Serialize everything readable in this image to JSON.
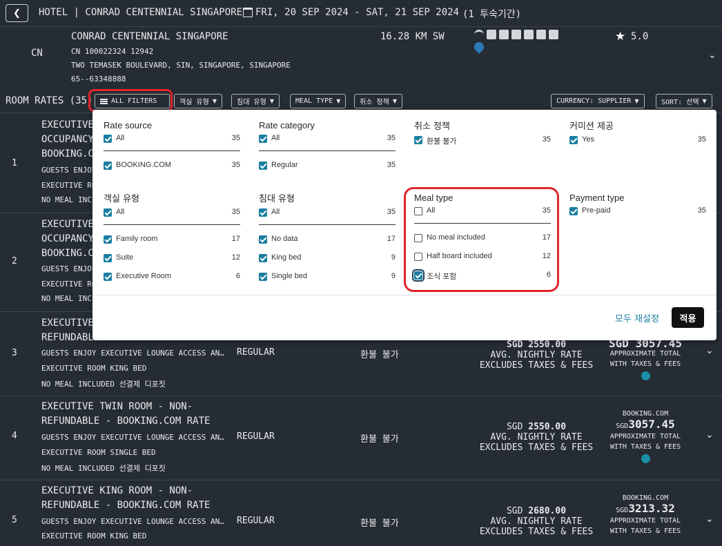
{
  "topbar": {
    "back_icon": "chevron-left-icon",
    "title": "HOTEL | CONRAD CENTENNIAL SINGAPORE",
    "dates": "FRI, 20 SEP 2024 - SAT, 21 SEP 2024",
    "nights": "(1 투숙기간)"
  },
  "hotel": {
    "code": "CN",
    "name": "CONRAD CENTENNIAL SINGAPORE",
    "ids": "CN 100022324 12942",
    "address": "TWO TEMASEK BOULEVARD, SIN, SINGAPORE, SINGAPORE",
    "phone": "65--63348888",
    "distance": "16.28 KM SW",
    "amenities": [
      "wifi-icon",
      "transfer-icon",
      "pool-icon",
      "coffee-icon",
      "bus-icon",
      "restaurant-icon",
      "parking-icon"
    ],
    "rating": "5.0"
  },
  "filterbar": {
    "label": "ROOM RATES (35)",
    "all_filters": "ALL FILTERS",
    "room_type": "객실 유형",
    "bed_type": "침대 유형",
    "meal_type": "MEAL TYPE",
    "cancel_policy": "취소 정책",
    "currency": "CURRENCY: SUPPLIER",
    "sort": "SORT: 선택"
  },
  "rows": [
    {
      "num": "1",
      "title1": "EXECUTIVE",
      "title2": "OCCUPANCY",
      "title3": "BOOKING.C",
      "l1": "GUESTS ENJOY",
      "l2": "EXECUTIVE RO",
      "l3": "NO MEAL INCLU"
    },
    {
      "num": "2",
      "title1": "EXECUTIVE",
      "title2": "OCCUPANCY",
      "title3": "BOOKING.C",
      "l1": "GUESTS ENJO",
      "l2": "EXECUTIVE RO",
      "l3": "NO MEAL INCL"
    },
    {
      "num": "3",
      "title1": "EXECUTIVE",
      "title2": "REFUNDABLE",
      "l1": "GUESTS ENJOY EXECUTIVE LOUNGE ACCESS AN…",
      "l2": "EXECUTIVE ROOM  KING BED",
      "l3": "NO MEAL INCLUDED   선결제   디포짓",
      "cat": "REGULAR",
      "cancel": "환불 불가",
      "price": "SGD 2550.00",
      "avg": "AVG. NIGHTLY RATE",
      "excl": "EXCLUDES TAXES & FEES",
      "total": "SGD 3057.45",
      "approx": "APPROXIMATE TOTAL",
      "with": "WITH TAXES & FEES"
    },
    {
      "num": "4",
      "title1": "EXECUTIVE TWIN ROOM - NON-",
      "title2": "REFUNDABLE - BOOKING.COM RATE",
      "l1": "GUESTS ENJOY EXECUTIVE LOUNGE ACCESS AN…",
      "l2": "EXECUTIVE ROOM  SINGLE BED",
      "l3": "NO MEAL INCLUDED   선결제   디포짓",
      "cat": "REGULAR",
      "cancel": "환불 불가",
      "price_cur": "SGD",
      "price": "2550.00",
      "avg": "AVG. NIGHTLY RATE",
      "excl": "EXCLUDES TAXES & FEES",
      "src": "BOOKING.COM",
      "total_cur": "SGD",
      "total": "3057.45",
      "approx": "APPROXIMATE TOTAL",
      "with": "WITH TAXES & FEES"
    },
    {
      "num": "5",
      "title1": "EXECUTIVE KING ROOM - NON-",
      "title2": "REFUNDABLE - BOOKING.COM RATE",
      "l1": "GUESTS ENJOY EXECUTIVE LOUNGE ACCESS AN…",
      "l2": "EXECUTIVE ROOM  KING BED",
      "cat": "REGULAR",
      "cancel": "환불 불가",
      "price_cur": "SGD",
      "price": "2680.00",
      "avg": "AVG. NIGHTLY RATE",
      "excl": "EXCLUDES TAXES & FEES",
      "src": "BOOKING.COM",
      "total_cur": "SGD",
      "total": "3213.32",
      "approx": "APPROXIMATE TOTAL",
      "with": "WITH TAXES & FEES"
    }
  ],
  "popup": {
    "rate_source": {
      "title": "Rate source",
      "all": "All",
      "all_count": "35",
      "opts": [
        {
          "label": "BOOKING.COM",
          "count": "35"
        }
      ]
    },
    "rate_category": {
      "title": "Rate category",
      "all": "All",
      "all_count": "35",
      "opts": [
        {
          "label": "Regular",
          "count": "35"
        }
      ]
    },
    "cancel_policy": {
      "title": "취소 정책",
      "opts": [
        {
          "label": "환불 불가",
          "count": "35"
        }
      ]
    },
    "commission": {
      "title": "커미션 제공",
      "opts": [
        {
          "label": "Yes",
          "count": "35"
        }
      ]
    },
    "room_type": {
      "title": "객실 유형",
      "all": "All",
      "all_count": "35",
      "opts": [
        {
          "label": "Family room",
          "count": "17"
        },
        {
          "label": "Suite",
          "count": "12"
        },
        {
          "label": "Executive Room",
          "count": "6"
        }
      ]
    },
    "bed_type": {
      "title": "침대 유형",
      "all": "All",
      "all_count": "35",
      "opts": [
        {
          "label": "No data",
          "count": "17"
        },
        {
          "label": "King bed",
          "count": "9"
        },
        {
          "label": "Single bed",
          "count": "9"
        }
      ]
    },
    "meal_type": {
      "title": "Meal type",
      "all": "All",
      "all_count": "35",
      "opts": [
        {
          "label": "No meal included",
          "count": "17"
        },
        {
          "label": "Half board included",
          "count": "12"
        },
        {
          "label": "조식 포함",
          "count": "6"
        }
      ]
    },
    "payment_type": {
      "title": "Payment type",
      "opts": [
        {
          "label": "Pre-paid",
          "count": "35"
        }
      ]
    },
    "reset": "모두 재설정",
    "apply": "적용"
  },
  "colors": {
    "bg": "#262c33",
    "accent": "#1a7fa0",
    "highlight": "#e0242a"
  }
}
